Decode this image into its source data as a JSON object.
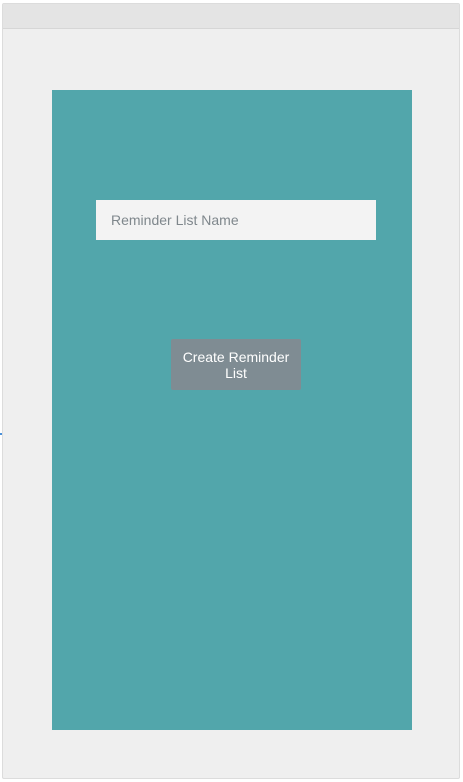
{
  "window": {
    "title": ""
  },
  "form": {
    "name_placeholder": "Reminder List Name",
    "name_value": "",
    "create_button_label": "Create Reminder List"
  },
  "colors": {
    "panel_background": "#52a6ab",
    "input_background": "#f3f3f3",
    "button_background": "#7f8c93",
    "button_text": "#ffffff",
    "window_background": "#efefef"
  }
}
